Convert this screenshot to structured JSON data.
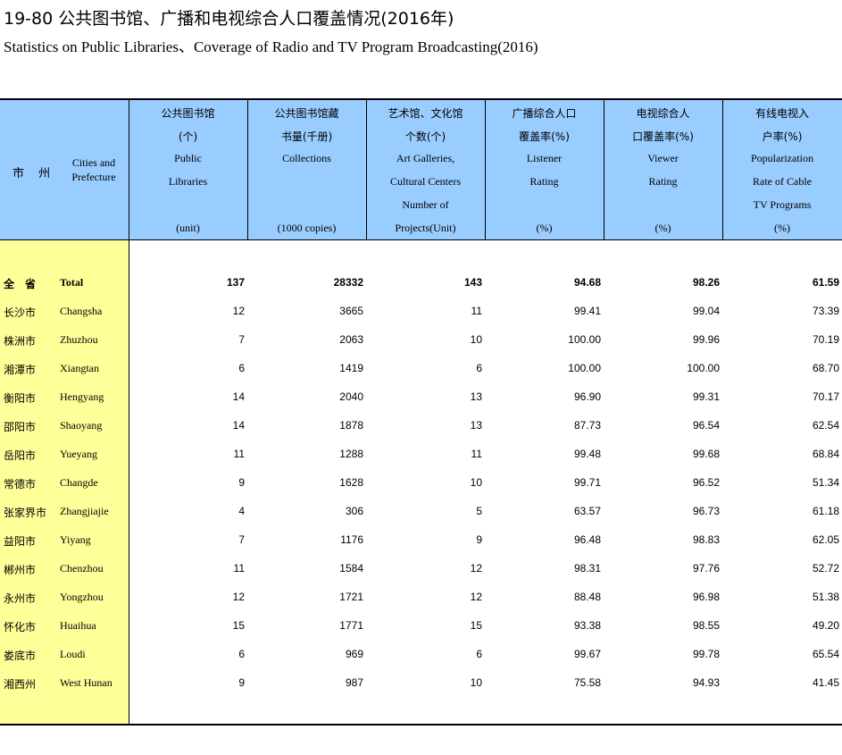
{
  "title": {
    "cn": "19-80    公共图书馆、广播和电视综合人口覆盖情况(2016年)",
    "en": "Statistics on Public Libraries、Coverage of Radio and TV  Program Broadcasting(2016)"
  },
  "stub": {
    "cn": "市 州",
    "en": "Cities and Prefecture"
  },
  "columns": [
    {
      "lines": [
        "公共图书馆",
        "(个)",
        "Public",
        "Libraries",
        "",
        "(unit)"
      ]
    },
    {
      "lines": [
        "公共图书馆藏",
        "书量(千册)",
        "Collections",
        "",
        "",
        "(1000 copies)"
      ]
    },
    {
      "lines": [
        "艺术馆、文化馆",
        "个数(个)",
        "Art Galleries,",
        "Cultural Centers",
        "Number of",
        "Projects(Unit)"
      ]
    },
    {
      "lines": [
        "广播综合人口",
        "覆盖率(%)",
        "Listener",
        "Rating",
        "",
        "(%)"
      ]
    },
    {
      "lines": [
        "电视综合人",
        "口覆盖率(%)",
        "Viewer",
        "Rating",
        "",
        "(%)"
      ]
    },
    {
      "lines": [
        "有线电视入",
        "户率(%)",
        "Popularization",
        "Rate of Cable",
        "TV Programs",
        "(%)"
      ]
    }
  ],
  "rows": [
    {
      "cn": "全　省",
      "en": "Total",
      "values": [
        "137",
        "28332",
        "143",
        "94.68",
        "98.26",
        "61.59"
      ]
    },
    {
      "cn": "长沙市",
      "en": "Changsha",
      "values": [
        "12",
        "3665",
        "11",
        "99.41",
        "99.04",
        "73.39"
      ]
    },
    {
      "cn": "株洲市",
      "en": "Zhuzhou",
      "values": [
        "7",
        "2063",
        "10",
        "100.00",
        "99.96",
        "70.19"
      ]
    },
    {
      "cn": "湘潭市",
      "en": "Xiangtan",
      "values": [
        "6",
        "1419",
        "6",
        "100.00",
        "100.00",
        "68.70"
      ]
    },
    {
      "cn": "衡阳市",
      "en": "Hengyang",
      "values": [
        "14",
        "2040",
        "13",
        "96.90",
        "99.31",
        "70.17"
      ]
    },
    {
      "cn": "邵阳市",
      "en": "Shaoyang",
      "values": [
        "14",
        "1878",
        "13",
        "87.73",
        "96.54",
        "62.54"
      ]
    },
    {
      "cn": "岳阳市",
      "en": "Yueyang",
      "values": [
        "11",
        "1288",
        "11",
        "99.48",
        "99.68",
        "68.84"
      ]
    },
    {
      "cn": "常德市",
      "en": "Changde",
      "values": [
        "9",
        "1628",
        "10",
        "99.71",
        "96.52",
        "51.34"
      ]
    },
    {
      "cn": "张家界市",
      "en": "Zhangjiajie",
      "values": [
        "4",
        "306",
        "5",
        "63.57",
        "96.73",
        "61.18"
      ]
    },
    {
      "cn": "益阳市",
      "en": "Yiyang",
      "values": [
        "7",
        "1176",
        "9",
        "96.48",
        "98.83",
        "62.05"
      ]
    },
    {
      "cn": "郴州市",
      "en": "Chenzhou",
      "values": [
        "11",
        "1584",
        "12",
        "98.31",
        "97.76",
        "52.72"
      ]
    },
    {
      "cn": "永州市",
      "en": "Yongzhou",
      "values": [
        "12",
        "1721",
        "12",
        "88.48",
        "96.98",
        "51.38"
      ]
    },
    {
      "cn": "怀化市",
      "en": "Huaihua",
      "values": [
        "15",
        "1771",
        "15",
        "93.38",
        "98.55",
        "49.20"
      ]
    },
    {
      "cn": "娄底市",
      "en": "Loudi",
      "values": [
        "6",
        "969",
        "6",
        "99.67",
        "99.78",
        "65.54"
      ]
    },
    {
      "cn": "湘西州",
      "en": "West Hunan",
      "values": [
        "9",
        "987",
        "10",
        "75.58",
        "94.93",
        "41.45"
      ]
    }
  ],
  "colors": {
    "header_bg": "#99ccff",
    "stub_bg": "#ffff99"
  }
}
